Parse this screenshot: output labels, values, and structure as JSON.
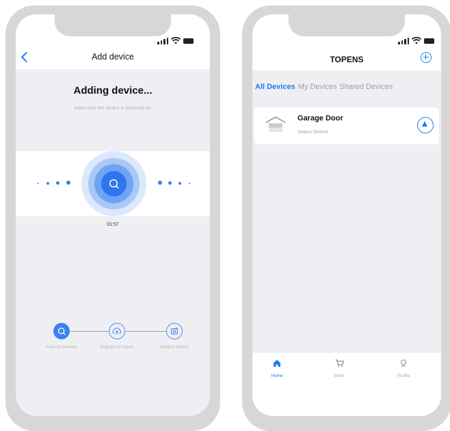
{
  "left_screen": {
    "header": {
      "title": "Add device"
    },
    "heading": "Adding device...",
    "hint": "Make sure the device is powered on.",
    "timer": "01:57",
    "steps": [
      {
        "label": "Scan for Devices",
        "state": "active"
      },
      {
        "label": "Register on Cloud.",
        "state": "pending"
      },
      {
        "label": "Initialize Device",
        "state": "pending"
      }
    ],
    "icons": [
      "back-chevron-icon",
      "search-icon",
      "cloud-upload-icon",
      "device-init-icon"
    ]
  },
  "right_screen": {
    "header": {
      "title": "TOPENS"
    },
    "tabs": [
      {
        "label": "All Devices",
        "active": true
      },
      {
        "label": "My Devices",
        "active": false
      },
      {
        "label": "Shared Devices",
        "active": false
      }
    ],
    "device": {
      "name": "Garage Door",
      "status": "Status:Online"
    },
    "tabbar": [
      {
        "label": "Home",
        "active": true,
        "icon": "home-icon"
      },
      {
        "label": "Store",
        "active": false,
        "icon": "cart-icon"
      },
      {
        "label": "Profile",
        "active": false,
        "icon": "profile-icon"
      }
    ]
  },
  "colors": {
    "accent": "#1e7cf3",
    "background": "#efeff3",
    "frame": "#d7d7d7"
  }
}
